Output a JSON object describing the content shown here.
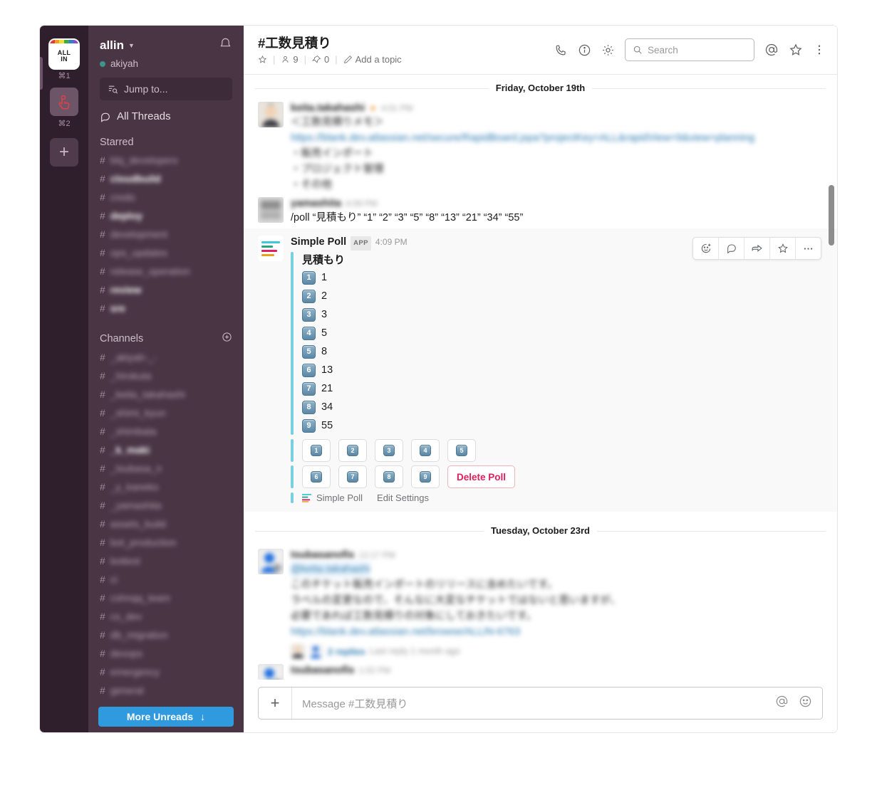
{
  "window": {
    "traffic_lights": [
      "#ff5f57",
      "#ffbd2e",
      "#28c840"
    ]
  },
  "rail": {
    "workspaces": [
      {
        "name": "ALL IN",
        "line1": "ALL",
        "line2": "IN",
        "shortcut": "⌘1",
        "type": "logo"
      },
      {
        "name": "touch-workspace",
        "shortcut": "⌘2",
        "type": "hand"
      }
    ],
    "add_label": "+"
  },
  "sidebar": {
    "team_name": "allin",
    "user_name": "akiyah",
    "presence_color": "#38978d",
    "jump_to": "Jump to...",
    "all_threads": "All Threads",
    "starred_label": "Starred",
    "starred": [
      {
        "name": "blq_developers",
        "unread": false
      },
      {
        "name": "cloudbuild",
        "unread": true
      },
      {
        "name": "credo",
        "unread": false
      },
      {
        "name": "deploy",
        "unread": true
      },
      {
        "name": "development",
        "unread": false
      },
      {
        "name": "ops_updates",
        "unread": false
      },
      {
        "name": "release_operation",
        "unread": false
      },
      {
        "name": "review",
        "unread": true
      },
      {
        "name": "sre",
        "unread": true
      }
    ],
    "channels_label": "Channels",
    "channels": [
      {
        "name": "_akiyah-_-",
        "unread": false
      },
      {
        "name": "_hirokuta",
        "unread": false
      },
      {
        "name": "_keita_takahashi",
        "unread": false
      },
      {
        "name": "_shimi_kyun",
        "unread": false
      },
      {
        "name": "_shimbata",
        "unread": false
      },
      {
        "name": "_k_maki",
        "unread": true
      },
      {
        "name": "_tsubasa_n",
        "unread": false
      },
      {
        "name": "_y_kaneko",
        "unread": false
      },
      {
        "name": "_yamashita",
        "unread": false
      },
      {
        "name": "assets_build",
        "unread": false
      },
      {
        "name": "bot_production",
        "unread": false
      },
      {
        "name": "bottest",
        "unread": false
      },
      {
        "name": "ci",
        "unread": false
      },
      {
        "name": "cshnqq_team",
        "unread": false
      },
      {
        "name": "cs_dev",
        "unread": false
      },
      {
        "name": "db_migration",
        "unread": false
      },
      {
        "name": "devops",
        "unread": false
      },
      {
        "name": "emergency",
        "unread": false
      },
      {
        "name": "general",
        "unread": false
      }
    ],
    "more_unreads": "More Unreads",
    "more_unreads_arrow": "↓"
  },
  "channel_header": {
    "title": "#工数見積り",
    "star_icon": "star-outline-icon",
    "member_count": "9",
    "pin_count": "0",
    "add_topic": "Add a topic",
    "actions": [
      {
        "icon": "phone-icon",
        "name": "call-button"
      },
      {
        "icon": "info-icon",
        "name": "channel-info-button"
      },
      {
        "icon": "gear-icon",
        "name": "channel-settings-button"
      }
    ],
    "search_placeholder": "Search",
    "right_actions": [
      {
        "icon": "at-icon",
        "name": "mentions-button"
      },
      {
        "icon": "star-icon",
        "name": "starred-items-button"
      },
      {
        "icon": "more-vertical-icon",
        "name": "more-options-button"
      }
    ]
  },
  "messages": {
    "divider_1": "Friday, October 19th",
    "divider_2": "Tuesday, October 23rd",
    "msg1": {
      "author": "keita.takahashi",
      "timestamp": "4:01 PM",
      "lines": [
        "＜工数見積りメモ＞",
        "https://blank.dev.atlassian.net/secure/RapidBoard.jspa?projectKey=ALL&rapidView=9&view=planning",
        "・販売インポート",
        "・プロジェクト管理",
        "・その他"
      ]
    },
    "msg2": {
      "author": "yamashita",
      "timestamp": "4:09 PM",
      "text": "/poll “見積もり” “1” “2” “3” “5” “8” “13” “21” “34” “55”"
    },
    "poll": {
      "app_name": "Simple Poll",
      "app_badge": "APP",
      "timestamp": "4:09 PM",
      "title": "見積もり",
      "accent_color": "#79cfdf",
      "options": [
        {
          "num": "1",
          "label": "1"
        },
        {
          "num": "2",
          "label": "2"
        },
        {
          "num": "3",
          "label": "3"
        },
        {
          "num": "4",
          "label": "5"
        },
        {
          "num": "5",
          "label": "8"
        },
        {
          "num": "6",
          "label": "13"
        },
        {
          "num": "7",
          "label": "21"
        },
        {
          "num": "8",
          "label": "34"
        },
        {
          "num": "9",
          "label": "55"
        }
      ],
      "vote_buttons_row1": [
        "1",
        "2",
        "3",
        "4",
        "5"
      ],
      "vote_buttons_row2": [
        "6",
        "7",
        "8",
        "9"
      ],
      "delete_label": "Delete Poll",
      "delete_color": "#e01e5a",
      "footer_app": "Simple Poll",
      "footer_settings": "Edit Settings"
    },
    "hover_actions": [
      {
        "icon": "add-reaction-icon",
        "name": "add-reaction-button"
      },
      {
        "icon": "thread-icon",
        "name": "start-thread-button"
      },
      {
        "icon": "share-arrow-icon",
        "name": "share-message-button"
      },
      {
        "icon": "star-icon",
        "name": "star-message-button"
      },
      {
        "icon": "more-horizontal-icon",
        "name": "more-actions-button"
      }
    ],
    "msg3": {
      "author": "tsubasanofis",
      "timestamp": "12:17 PM",
      "mention": "@keita.takahashi",
      "lines": [
        "このチケット販売インポートのリリースに含めたいです。",
        "ラベルの変更なので、そんなに大変なチケットではないと思いますが、",
        "必要であれば工数見積りの対象にしておきたいです。",
        "https://blank.dev.atlassian.net/browse/ALLIN-6763"
      ],
      "reply_count": "2 replies",
      "last_reply": "Last reply 1 month ago"
    },
    "msg4": {
      "author": "tsubasanofis",
      "timestamp": "1:02 PM"
    }
  },
  "composer": {
    "plus_label": "+",
    "placeholder": "Message #工数見積り",
    "at_icon": "at-icon",
    "emoji_icon": "emoji-icon"
  }
}
